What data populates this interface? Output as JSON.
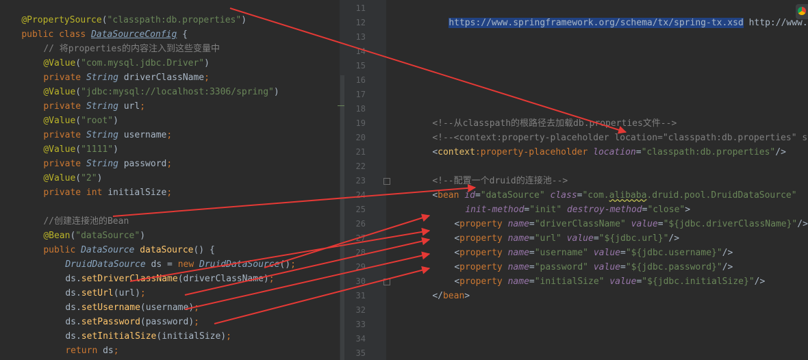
{
  "java": {
    "l1": {
      "ann": "@PropertySource",
      "paren": "(",
      "str": "\"classpath:db.properties\"",
      "close": ")"
    },
    "l2": {
      "kw": "public class ",
      "cls": "DataSourceConfig",
      "rest": " {"
    },
    "l3": {
      "comment": "// 将properties的内容注入到这些变量中"
    },
    "l4": {
      "ann": "@Value",
      "open": "(",
      "str": "\"com.mysql.jdbc.Driver\"",
      "close": ")"
    },
    "l5": {
      "kw": "private ",
      "typ": "String",
      "name": " driverClassName",
      "semi": ";"
    },
    "l6": {
      "ann": "@Value",
      "open": "(",
      "str": "\"jdbc:mysql://localhost:3306/spring\"",
      "close": ")"
    },
    "l7": {
      "kw": "private ",
      "typ": "String",
      "name": " url",
      "semi": ";"
    },
    "l8": {
      "ann": "@Value",
      "open": "(",
      "str": "\"root\"",
      "close": ")"
    },
    "l9": {
      "kw": "private ",
      "typ": "String",
      "name": " username",
      "semi": ";"
    },
    "l10": {
      "ann": "@Value",
      "open": "(",
      "str": "\"1111\"",
      "close": ")"
    },
    "l11": {
      "kw": "private ",
      "typ": "String",
      "name": " password",
      "semi": ";"
    },
    "l12": {
      "ann": "@Value",
      "open": "(",
      "str": "\"2\"",
      "close": ")"
    },
    "l13": {
      "kw": "private int",
      "name": " initialSize",
      "semi": ";"
    },
    "l15": {
      "comment": "//创建连接池的Bean"
    },
    "l16": {
      "ann": "@Bean",
      "open": "(",
      "str": "\"dataSource\"",
      "close": ")"
    },
    "l17": {
      "kw": "public ",
      "typ": "DataSource",
      "fn": " dataSource",
      "rest": "() {"
    },
    "l18": {
      "typ": "DruidDataSource",
      "name": " ds = ",
      "kw": "new ",
      "cls": "DruidDataSource",
      "rest": "()",
      "semi": ";"
    },
    "l19": {
      "obj": "ds.",
      "mth": "setDriverClassName",
      "arg": "(driverClassName)",
      "semi": ";"
    },
    "l20": {
      "obj": "ds.",
      "mth": "setUrl",
      "arg": "(url)",
      "semi": ";"
    },
    "l21": {
      "obj": "ds.",
      "mth": "setUsername",
      "arg": "(username)",
      "semi": ";"
    },
    "l22": {
      "obj": "ds.",
      "mth": "setPassword",
      "arg": "(password)",
      "semi": ";"
    },
    "l23": {
      "obj": "ds.",
      "mth": "setInitialSize",
      "arg": "(initialSize)",
      "semi": ";"
    },
    "l24": {
      "kw": "return ",
      "name": "ds",
      "semi": ";"
    },
    "l25": {
      "brace": "}"
    }
  },
  "xml": {
    "line_numbers": [
      "11",
      "12",
      "13",
      "14",
      "15",
      "16",
      "17",
      "18",
      "19",
      "20",
      "21",
      "22",
      "23",
      "24",
      "25",
      "26",
      "27",
      "28",
      "29",
      "30",
      "31",
      "32",
      "33",
      "34",
      "35"
    ],
    "l11": {
      "url": "https://www.springframework.org/schema/tx/spring-tx.xsd",
      "rest": " http://www.sp"
    },
    "l18": {
      "comment": "<!--从classpath的根路径去加载db.properties文件-->"
    },
    "l19": {
      "comment": "<!--<context:property-placeholder location=\"classpath:db.properties\" syst"
    },
    "l20": {
      "open": "<",
      "ns": "context",
      "tag": ":property-placeholder ",
      "attr": "location",
      "eq": "=",
      "val": "\"classpath:db.properties\"",
      "close": "/>"
    },
    "l22": {
      "comment": "<!--配置一个druid的连接池-->"
    },
    "l23": {
      "open": "<",
      "tag": "bean ",
      "a1": "id",
      "eq1": "=",
      "v1": "\"dataSource\"",
      "a2": " class",
      "eq2": "=",
      "v2a": "\"com.",
      "v2b": "alibaba",
      "v2c": ".druid.pool.DruidDataSource\""
    },
    "l24": {
      "a1": "init-method",
      "eq1": "=",
      "v1": "\"init\"",
      "a2": " destroy-method",
      "eq2": "=",
      "v2": "\"close\"",
      "close": ">"
    },
    "l25": {
      "open": "<",
      "tag": "property ",
      "a1": "name",
      "eq1": "=",
      "v1": "\"driverClassName\"",
      "a2": " value",
      "eq2": "=",
      "v2": "\"${jdbc.driverClassName}\"",
      "close": "/>"
    },
    "l26": {
      "open": "<",
      "tag": "property ",
      "a1": "name",
      "eq1": "=",
      "v1": "\"url\"",
      "a2": " value",
      "eq2": "=",
      "v2": "\"${jdbc.url}\"",
      "close": "/>"
    },
    "l27": {
      "open": "<",
      "tag": "property ",
      "a1": "name",
      "eq1": "=",
      "v1": "\"username\"",
      "a2": " value",
      "eq2": "=",
      "v2": "\"${jdbc.username}\"",
      "close": "/>"
    },
    "l28": {
      "open": "<",
      "tag": "property ",
      "a1": "name",
      "eq1": "=",
      "v1": "\"password\"",
      "a2": " value",
      "eq2": "=",
      "v2": "\"${jdbc.password}\"",
      "close": "/>"
    },
    "l29": {
      "open": "<",
      "tag": "property ",
      "a1": "name",
      "eq1": "=",
      "v1": "\"initialSize\"",
      "a2": " value",
      "eq2": "=",
      "v2": "\"${jdbc.initialSize}\"",
      "close": "/>"
    },
    "l30": {
      "open": "</",
      "tag": "bean",
      "close": ">"
    }
  },
  "colors": {
    "arrow": "#e53935",
    "background": "#2b2b2b",
    "gutter": "#313335"
  }
}
